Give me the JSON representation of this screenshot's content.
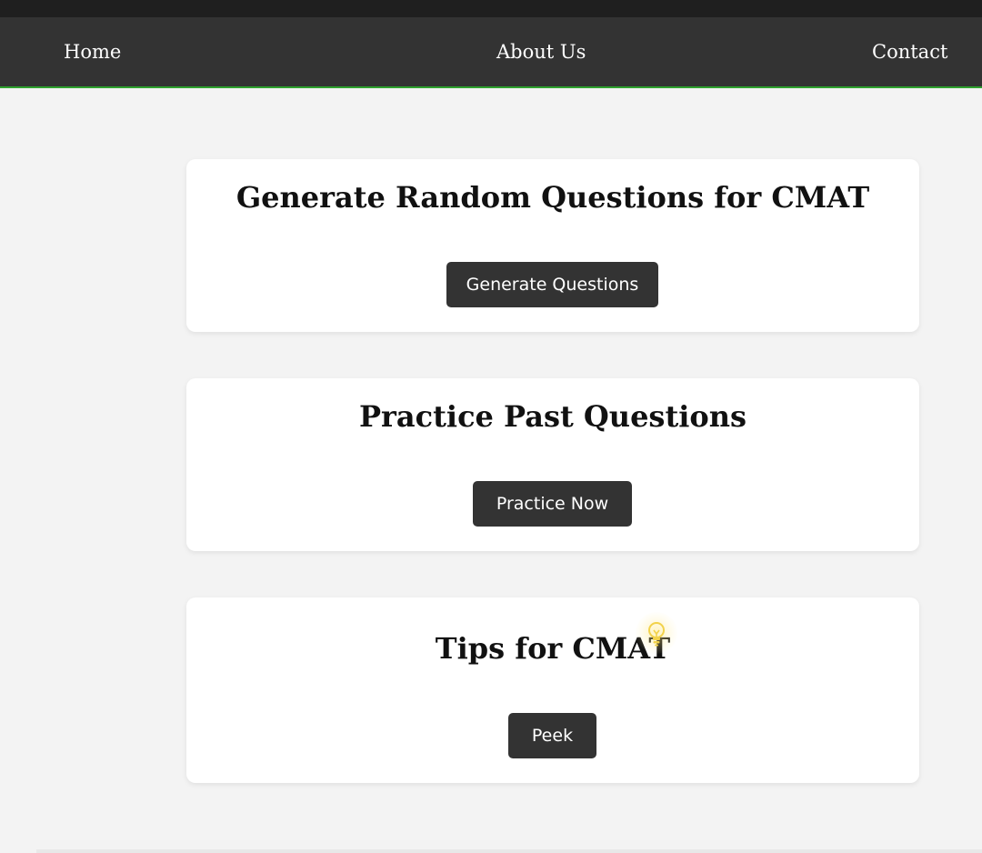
{
  "nav": {
    "home": "Home",
    "about": "About Us",
    "contact": "Contact"
  },
  "cards": [
    {
      "title": "Generate Random Questions for CMAT",
      "button": "Generate Questions"
    },
    {
      "title": "Practice Past Questions",
      "button": "Practice Now"
    },
    {
      "title": "Tips for CMAT",
      "button": "Peek",
      "icon": "lightbulb-icon"
    }
  ],
  "colors": {
    "navbar": "#333333",
    "nav_border": "#2ea22e",
    "background": "#f3f3f3",
    "button": "#333333",
    "bulb": "#f2d24a"
  }
}
